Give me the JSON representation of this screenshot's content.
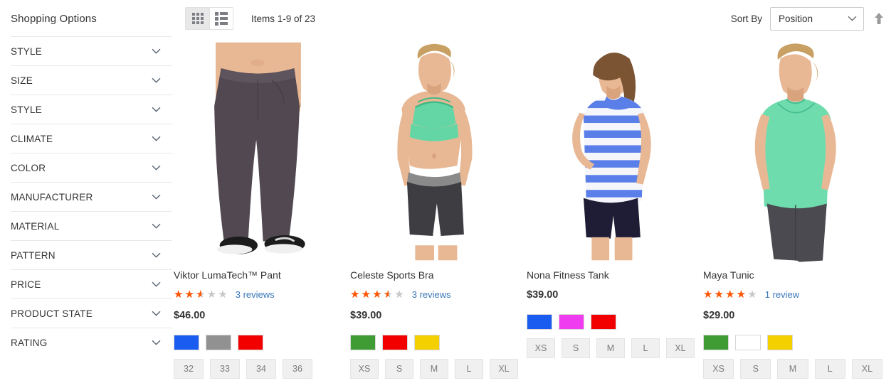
{
  "sidebar": {
    "title": "Shopping Options",
    "filters": [
      {
        "label": "STYLE"
      },
      {
        "label": "SIZE"
      },
      {
        "label": "STYLE"
      },
      {
        "label": "CLIMATE"
      },
      {
        "label": "COLOR"
      },
      {
        "label": "MANUFACTURER"
      },
      {
        "label": "MATERIAL"
      },
      {
        "label": "PATTERN"
      },
      {
        "label": "PRICE"
      },
      {
        "label": "PRODUCT STATE"
      },
      {
        "label": "RATING"
      }
    ]
  },
  "toolbar": {
    "grid_view_icon": "grid-view-icon",
    "list_view_icon": "list-view-icon",
    "items_count": "Items 1-9 of 23",
    "sort_label": "Sort By",
    "sort_value": "Position",
    "sort_direction_icon": "arrow-up-icon",
    "chevron_icon": "chevron-down-icon"
  },
  "products": [
    {
      "name": "Viktor LumaTech™ Pant",
      "rating_stars": 2.5,
      "rating_percent": "50%",
      "reviews": "3 reviews",
      "price": "$46.00",
      "colors": [
        "#1a5cf0",
        "#919191",
        "#f20000"
      ],
      "sizes": [
        "32",
        "33",
        "34",
        "36"
      ]
    },
    {
      "name": "Celeste Sports Bra",
      "rating_stars": 3.5,
      "rating_percent": "70%",
      "reviews": "3 reviews",
      "price": "$39.00",
      "colors": [
        "#3f9c35",
        "#f20000",
        "#f5d000"
      ],
      "sizes": [
        "XS",
        "S",
        "M",
        "L",
        "XL"
      ]
    },
    {
      "name": "Nona Fitness Tank",
      "rating_stars": 0,
      "rating_percent": "0%",
      "reviews": "",
      "price": "$39.00",
      "colors": [
        "#1a5cf0",
        "#f03cf0",
        "#f20000"
      ],
      "sizes": [
        "XS",
        "S",
        "M",
        "L",
        "XL"
      ]
    },
    {
      "name": "Maya Tunic",
      "rating_stars": 4,
      "rating_percent": "80%",
      "reviews": "1 review",
      "price": "$29.00",
      "colors": [
        "#3f9c35",
        "#ffffff",
        "#f5d000"
      ],
      "sizes": [
        "XS",
        "S",
        "M",
        "L",
        "XL"
      ]
    }
  ],
  "stars_glyphs": "★★★★★",
  "colors": {
    "star_filled": "#ff5501",
    "star_empty": "#c7c7c7",
    "link": "#3878b8",
    "text": "#333333"
  }
}
